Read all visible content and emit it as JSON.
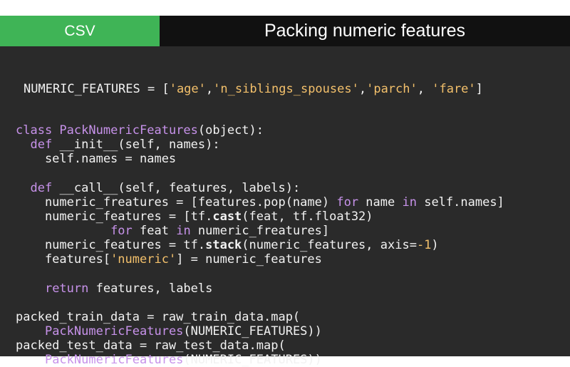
{
  "header": {
    "tab_label": "CSV",
    "title": "Packing numeric features"
  },
  "code": {
    "lines": [
      [
        {
          "t": "NUMERIC_FEATURES = [",
          "c": "plain"
        },
        {
          "t": "'age'",
          "c": "str"
        },
        {
          "t": ",",
          "c": "plain"
        },
        {
          "t": "'n_siblings_spouses'",
          "c": "str"
        },
        {
          "t": ",",
          "c": "plain"
        },
        {
          "t": "'parch'",
          "c": "str"
        },
        {
          "t": ", ",
          "c": "plain"
        },
        {
          "t": "'fare'",
          "c": "str"
        },
        {
          "t": "]",
          "c": "plain"
        }
      ],
      [
        {
          "t": "class ",
          "c": "kw"
        },
        {
          "t": "PackNumericFeatures",
          "c": "kw"
        },
        {
          "t": "(object):",
          "c": "plain"
        }
      ],
      [
        {
          "t": "  ",
          "c": "plain"
        },
        {
          "t": "def ",
          "c": "kw"
        },
        {
          "t": "__init__",
          "c": "plain"
        },
        {
          "t": "(self, names):",
          "c": "plain"
        }
      ],
      [
        {
          "t": "    self.names = names",
          "c": "plain"
        }
      ],
      [
        {
          "t": "  ",
          "c": "plain"
        },
        {
          "t": "def ",
          "c": "kw"
        },
        {
          "t": "__call__",
          "c": "plain"
        },
        {
          "t": "(self, features, labels):",
          "c": "plain"
        }
      ],
      [
        {
          "t": "    numeric_freatures = [features.pop(name) ",
          "c": "plain"
        },
        {
          "t": "for",
          "c": "kw"
        },
        {
          "t": " name ",
          "c": "plain"
        },
        {
          "t": "in",
          "c": "kw"
        },
        {
          "t": " self.names]",
          "c": "plain"
        }
      ],
      [
        {
          "t": "    numeric_features = [tf.",
          "c": "plain"
        },
        {
          "t": "cast",
          "c": "bold"
        },
        {
          "t": "(feat, tf.float32)",
          "c": "plain"
        }
      ],
      [
        {
          "t": "             ",
          "c": "plain"
        },
        {
          "t": "for",
          "c": "kw"
        },
        {
          "t": " feat ",
          "c": "plain"
        },
        {
          "t": "in",
          "c": "kw"
        },
        {
          "t": " numeric_freatures]",
          "c": "plain"
        }
      ],
      [
        {
          "t": "    numeric_features = tf.",
          "c": "plain"
        },
        {
          "t": "stack",
          "c": "bold"
        },
        {
          "t": "(numeric_features, axis=",
          "c": "plain"
        },
        {
          "t": "-1",
          "c": "num"
        },
        {
          "t": ")",
          "c": "plain"
        }
      ],
      [
        {
          "t": "    features[",
          "c": "plain"
        },
        {
          "t": "'numeric'",
          "c": "str"
        },
        {
          "t": "] = numeric_features",
          "c": "plain"
        }
      ],
      [
        {
          "t": "    ",
          "c": "plain"
        },
        {
          "t": "return",
          "c": "kw"
        },
        {
          "t": " features, labels",
          "c": "plain"
        }
      ],
      [
        {
          "t": "packed_train_data = raw_train_data.map(",
          "c": "plain"
        }
      ],
      [
        {
          "t": "    ",
          "c": "plain"
        },
        {
          "t": "PackNumericFeatures",
          "c": "kw"
        },
        {
          "t": "(NUMERIC_FEATURES))",
          "c": "plain"
        }
      ],
      [
        {
          "t": "packed_test_data = raw_test_data.map(",
          "c": "plain"
        }
      ],
      [
        {
          "t": "    ",
          "c": "plain"
        },
        {
          "t": "PackNumericFeatures",
          "c": "kw"
        },
        {
          "t": "(NUMERIC_FEATURES))",
          "c": "plain"
        }
      ]
    ]
  },
  "colors": {
    "tab_bg": "#3fb456",
    "header_bg": "#111111",
    "code_bg": "#2a2a2a",
    "keyword": "#c792ea",
    "string": "#f3c06b",
    "text": "#f2f2f2"
  }
}
